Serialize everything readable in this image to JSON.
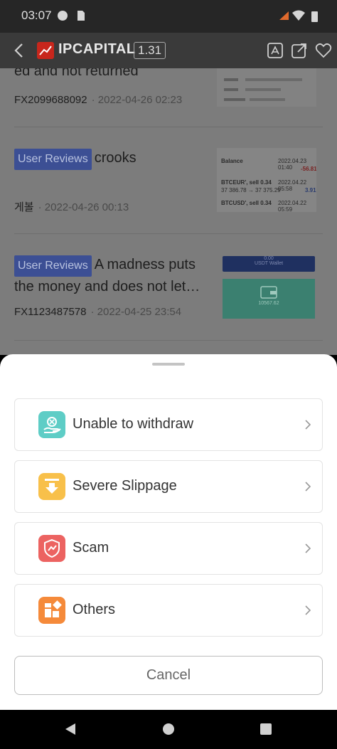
{
  "status_bar": {
    "time": "03:07"
  },
  "header": {
    "title": "IPCAPITAL",
    "score": "1.31"
  },
  "reviews": [
    {
      "tag": "",
      "title": "ed and not returned",
      "author": "FX2099688092",
      "date": "· 2022-04-26 02:23"
    },
    {
      "tag": "User Reviews",
      "title": "crooks",
      "author": "게볼",
      "date": "· 2022-04-26 00:13"
    },
    {
      "tag": "User Reviews",
      "title": "A madness puts the money and does not let…",
      "author": "FX1123487578",
      "date": "· 2022-04-25 23:54"
    }
  ],
  "thumb2": {
    "balance_label": "Balance",
    "balance_date": "2022.04.23 01:40",
    "balance_value": "-56.81",
    "row1_pair": "BTCEUR', sell 0.34",
    "row1_date": "2022.04.22 05:58",
    "row1_prices": "37 386.78 → 37 375.29",
    "row1_profit": "3.91",
    "row2_pair": "BTCUSD', sell 0.34",
    "row2_date": "2022.04.22 05:59"
  },
  "thumb3": {
    "amount": "0.00",
    "wallet_label": "USDT Wallet",
    "value": "10567.62"
  },
  "sheet": {
    "options": [
      {
        "label": "Unable to withdraw",
        "icon": "withdraw-hand-icon",
        "color": "#5ecdc6"
      },
      {
        "label": "Severe Slippage",
        "icon": "slippage-arrow-icon",
        "color": "#f8c04a"
      },
      {
        "label": "Scam",
        "icon": "scam-shield-icon",
        "color": "#ec6361"
      },
      {
        "label": "Others",
        "icon": "others-grid-icon",
        "color": "#f58a3a"
      }
    ],
    "cancel_label": "Cancel"
  }
}
